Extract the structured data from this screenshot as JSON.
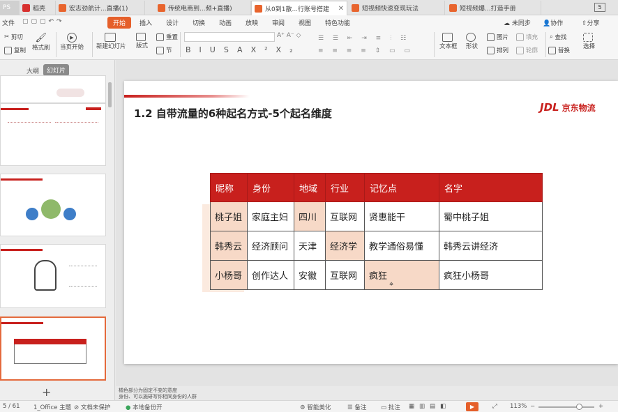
{
  "tabs": [
    {
      "label": "PS",
      "kind": "app"
    },
    {
      "label": "稻壳",
      "kind": "red"
    },
    {
      "label": "宏志劲航计...直播(1)",
      "kind": "orange"
    },
    {
      "label": "传统电商到...频+直播)",
      "kind": "orange"
    },
    {
      "label": "从0到1散...行账号搭建",
      "kind": "orange",
      "active": true
    },
    {
      "label": "短视频快速变现玩法",
      "kind": "orange"
    },
    {
      "label": "短视频爆...打造手册",
      "kind": "orange"
    }
  ],
  "tab_counter": "5",
  "menu": {
    "file": "文件",
    "items": [
      "开始",
      "插入",
      "设计",
      "切换",
      "动画",
      "放映",
      "审阅",
      "视图",
      "特色功能"
    ],
    "right": [
      "未同步",
      "协作",
      "分享"
    ]
  },
  "ribbon": {
    "cut": "剪切",
    "copy": "复制",
    "format_painter": "格式刷",
    "slide_start": "当页开始",
    "new_slide": "新建幻灯片",
    "layout": "版式",
    "section": "节",
    "reset": "重置",
    "font_buttons": [
      "B",
      "I",
      "U",
      "S",
      "A",
      "X²",
      "X₂"
    ],
    "textbox": "文本框",
    "shape": "形状",
    "arrange": "排列",
    "picture": "图片",
    "fill": "填充",
    "outline": "轮廓",
    "find": "查找",
    "replace": "替换",
    "select": "选择"
  },
  "panel": {
    "outline_tab": "大纲",
    "slides_tab": "幻灯片",
    "add": "+"
  },
  "slide": {
    "title": "1.2 自带流量的6种起名方式-5个起名维度",
    "logo_mark": "JDL",
    "logo_text": "京东物流",
    "table": {
      "headers": [
        "昵称",
        "身份",
        "地域",
        "行业",
        "记忆点",
        "名字"
      ],
      "rows": [
        [
          "桃子姐",
          "家庭主妇",
          "四川",
          "互联网",
          "贤惠能干",
          "蜀中桃子姐"
        ],
        [
          "韩秀云",
          "经济顾问",
          "天津",
          "经济学",
          "教学通俗易懂",
          "韩秀云讲经济"
        ],
        [
          "小杨哥",
          "创作达人",
          "安徽",
          "互联网",
          "疯狂",
          "疯狂小杨哥"
        ]
      ]
    }
  },
  "notes": [
    "橘色部分为固定不变的意度",
    "身份、可以施研写你相同身份的人群"
  ],
  "status": {
    "page": "5 / 61",
    "theme": "1_Office 主题",
    "protect": "文档未保护",
    "backup": "本地备份开",
    "beautify": "智能美化",
    "notes": "备注",
    "comment": "批注",
    "zoom": "113%"
  }
}
